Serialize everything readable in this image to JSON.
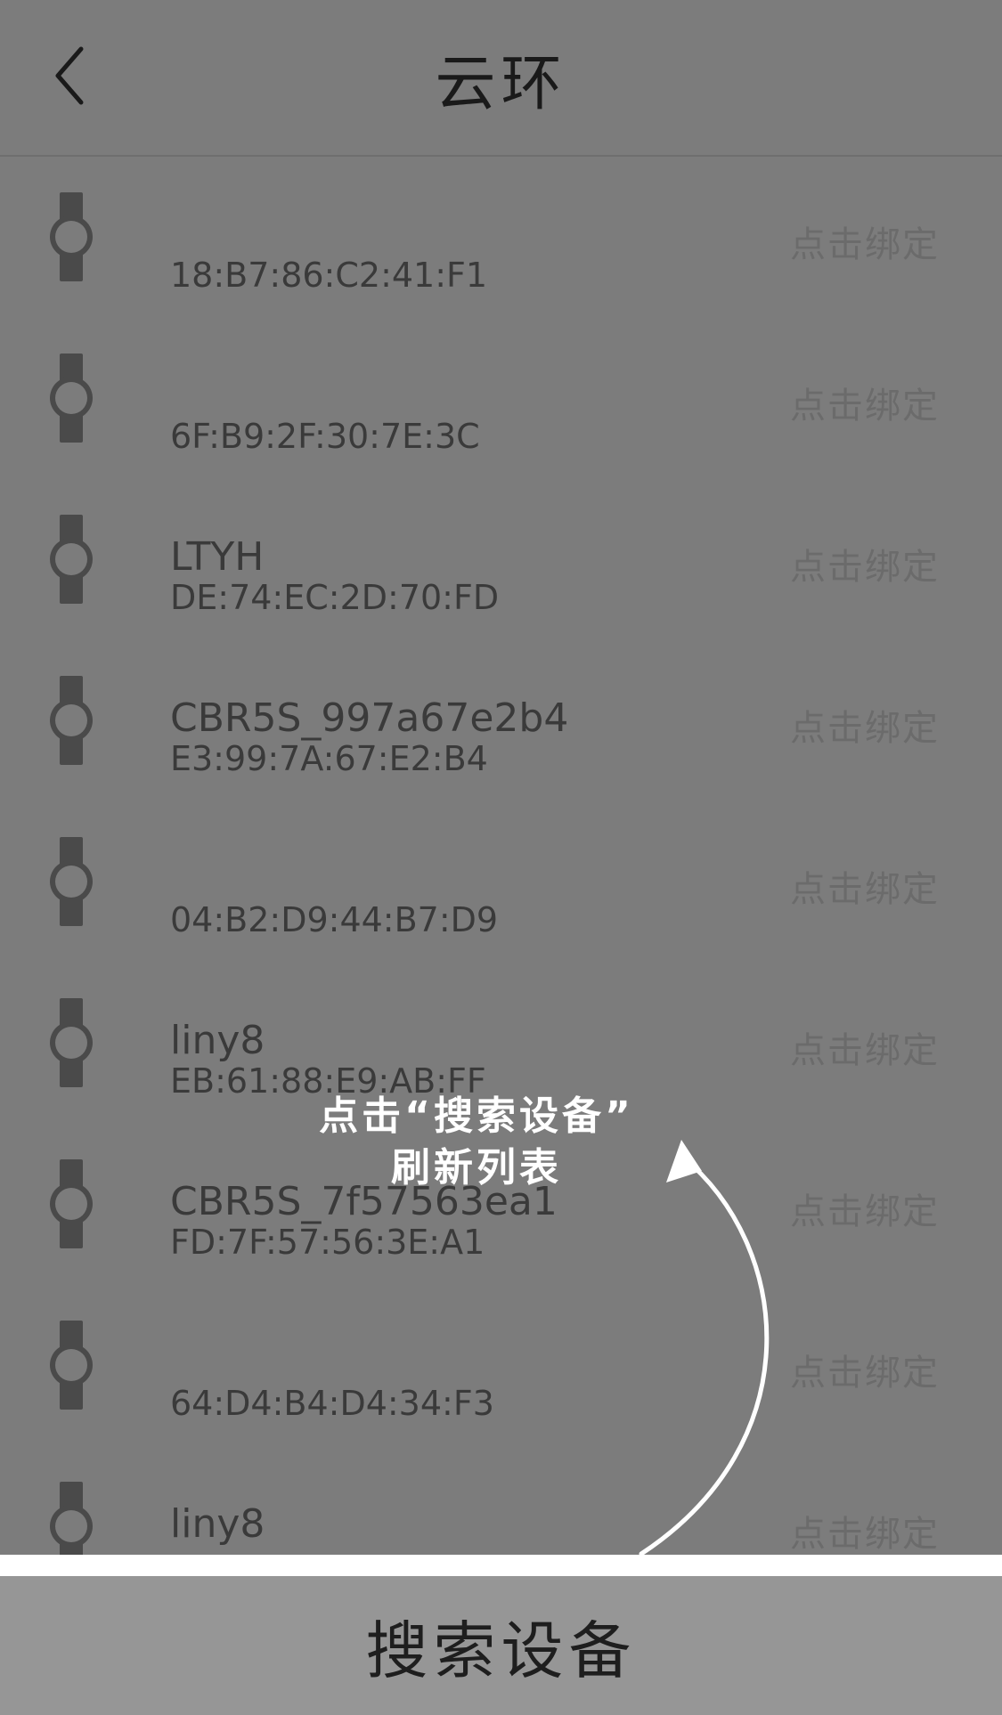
{
  "header": {
    "title": "云环",
    "back_icon": "chevron-left-icon"
  },
  "devices": [
    {
      "name": "",
      "mac": "18:B7:86:C2:41:F1",
      "action": "点击绑定"
    },
    {
      "name": "",
      "mac": "6F:B9:2F:30:7E:3C",
      "action": "点击绑定"
    },
    {
      "name": "LTYH",
      "mac": "DE:74:EC:2D:70:FD",
      "action": "点击绑定"
    },
    {
      "name": "CBR5S_997a67e2b4",
      "mac": "E3:99:7A:67:E2:B4",
      "action": "点击绑定"
    },
    {
      "name": "",
      "mac": "04:B2:D9:44:B7:D9",
      "action": "点击绑定"
    },
    {
      "name": "liny8",
      "mac": "EB:61:88:E9:AB:FF",
      "action": "点击绑定"
    },
    {
      "name": "CBR5S_7f57563ea1",
      "mac": "FD:7F:57:56:3E:A1",
      "action": "点击绑定"
    },
    {
      "name": "",
      "mac": "64:D4:B4:D4:34:F3",
      "action": "点击绑定"
    },
    {
      "name": "liny8",
      "mac": "",
      "action": "点击绑定"
    }
  ],
  "device_icon": "watch-icon",
  "tip": {
    "line1": "点击“搜索设备”",
    "line2": "刷新列表"
  },
  "search_button": {
    "label": "搜索设备"
  },
  "colors": {
    "overlay": "#7c7c7c",
    "button": "#969696",
    "tip_text": "#ffffff"
  }
}
